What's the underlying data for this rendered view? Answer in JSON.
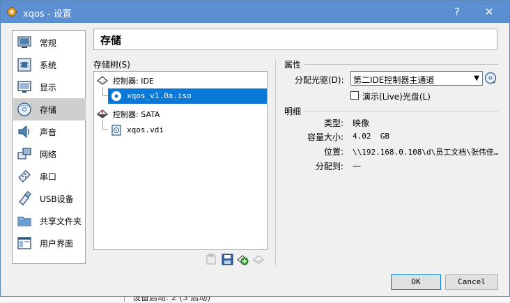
{
  "window": {
    "title": "xqos - 设置",
    "help_label": "?",
    "close_label": "✕"
  },
  "sidebar": {
    "items": [
      {
        "label": "常规",
        "icon": "general-icon"
      },
      {
        "label": "系统",
        "icon": "system-icon"
      },
      {
        "label": "显示",
        "icon": "display-icon"
      },
      {
        "label": "存储",
        "icon": "storage-icon",
        "selected": true
      },
      {
        "label": "声音",
        "icon": "audio-icon"
      },
      {
        "label": "网络",
        "icon": "network-icon"
      },
      {
        "label": "串口",
        "icon": "serial-port-icon"
      },
      {
        "label": "USB设备",
        "icon": "usb-icon"
      },
      {
        "label": "共享文件夹",
        "icon": "shared-folder-icon"
      },
      {
        "label": "用户界面",
        "icon": "user-interface-icon"
      }
    ]
  },
  "page": {
    "title": "存储"
  },
  "storage_tree": {
    "label": "存储树(S)",
    "rows": [
      {
        "text": "控制器: IDE",
        "type": "controller"
      },
      {
        "text": "xqos_v1.0a.iso",
        "type": "optical",
        "selected": true
      },
      {
        "text": "控制器: SATA",
        "type": "controller"
      },
      {
        "text": "xqos.vdi",
        "type": "disk"
      }
    ]
  },
  "attributes": {
    "section_label": "属性",
    "optical_drive_label": "分配光驱(D):",
    "optical_drive_value": "第二IDE控制器主通道",
    "live_cd_label": "演示(Live)光盘(L)",
    "live_cd_checked": false
  },
  "details": {
    "section_label": "明细",
    "rows": [
      {
        "key": "类型:",
        "value": "映像"
      },
      {
        "key": "容量大小:",
        "value": "4.02  GB"
      },
      {
        "key": "位置:",
        "value": "\\\\192.168.0.108\\d\\员工文档\\张伟佳…"
      },
      {
        "key": "分配到:",
        "value": "一"
      }
    ]
  },
  "buttons": {
    "ok": "OK",
    "cancel": "Cancel"
  },
  "background_peek": {
    "text": "设备启动:    2 (3 启动)"
  },
  "colors": {
    "titlebar": "#5b8fd1",
    "selection": "#0a78d7",
    "sidebar_selected": "#cfcfcf"
  }
}
